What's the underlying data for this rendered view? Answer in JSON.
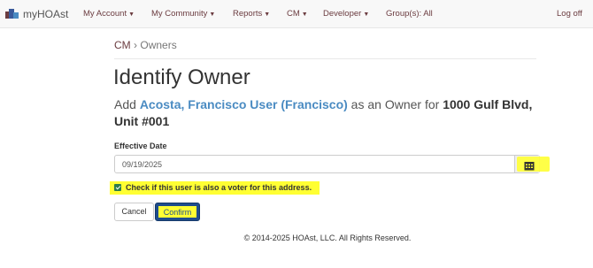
{
  "brand": {
    "name": "myHOAst"
  },
  "nav": {
    "items": [
      {
        "label": "My Account",
        "dropdown": true
      },
      {
        "label": "My Community",
        "dropdown": true
      },
      {
        "label": "Reports",
        "dropdown": true
      },
      {
        "label": "CM",
        "dropdown": true
      },
      {
        "label": "Developer",
        "dropdown": true
      },
      {
        "label": "Group(s): All",
        "dropdown": false
      }
    ],
    "logoff": "Log off"
  },
  "breadcrumb": {
    "parent": "CM",
    "separator": "›",
    "current": "Owners"
  },
  "page": {
    "title": "Identify Owner",
    "subtitle_prefix": "Add ",
    "user_name": "Acosta, Francisco User (Francisco)",
    "subtitle_middle": " as an Owner for ",
    "unit": "1000 Gulf Blvd, Unit #001"
  },
  "form": {
    "effective_date_label": "Effective Date",
    "effective_date_value": "09/19/2025",
    "voter_checkbox_label": "Check if this user is also a voter for this address.",
    "voter_checked": true,
    "cancel_label": "Cancel",
    "confirm_label": "Confirm"
  },
  "footer": {
    "text": "© 2014-2025 HOAst, LLC. All Rights Reserved."
  },
  "colors": {
    "nav_link": "#6b3c40",
    "link_blue": "#4a8bc2",
    "primary_button": "#1f4d8c",
    "highlight": "#ffff33",
    "checkbox_green": "#2e7d4a"
  },
  "icons": {
    "brand": "logo-icon",
    "calendar": "calendar-icon",
    "caret": "caret-down-icon"
  }
}
